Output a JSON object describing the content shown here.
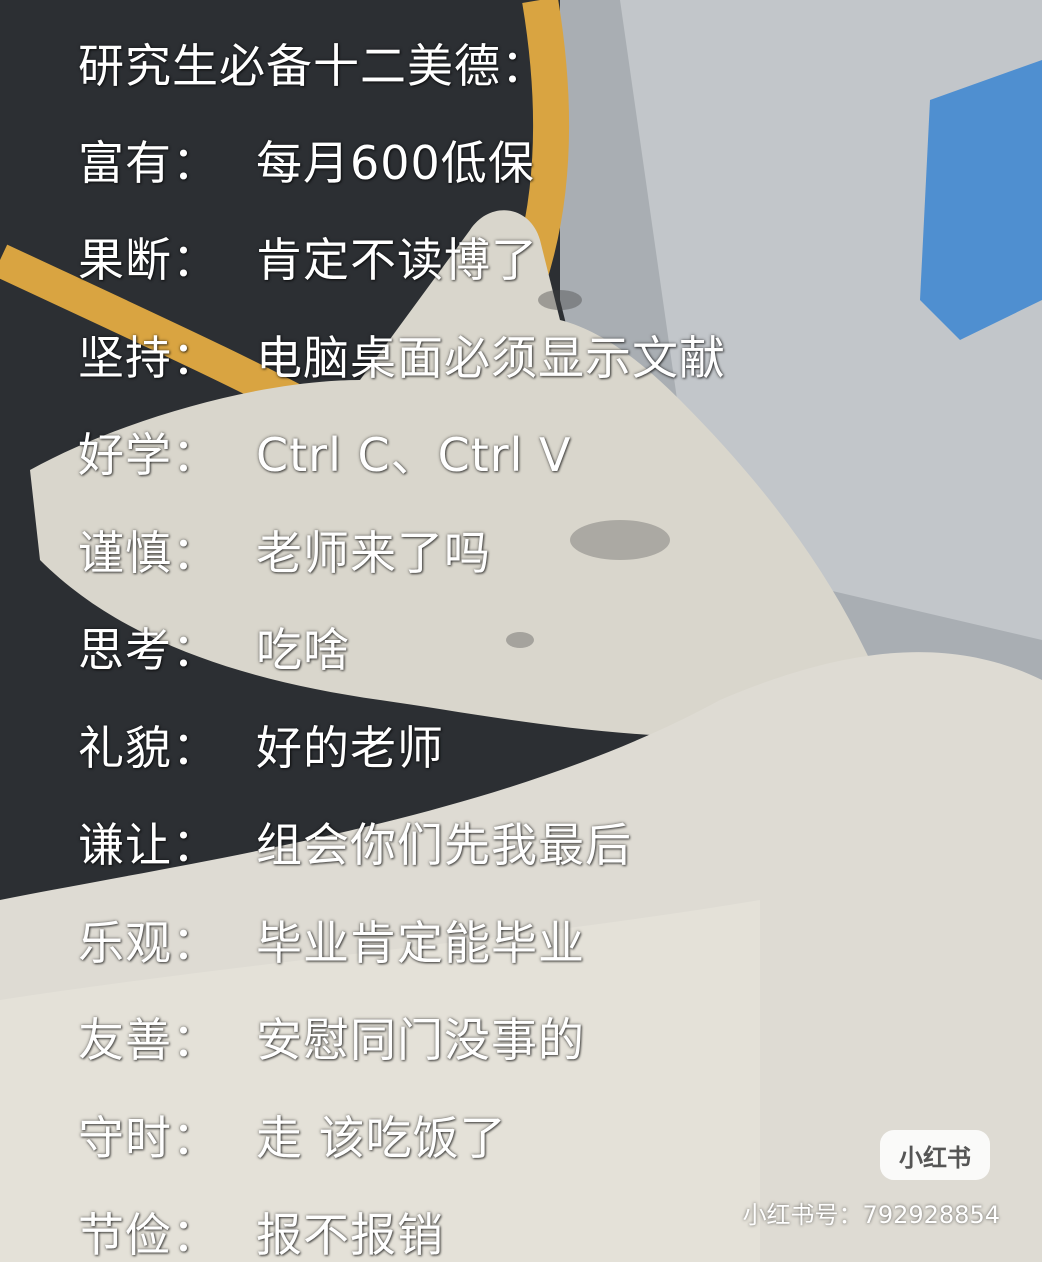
{
  "title": "研究生必备十二美德：",
  "virtues": [
    {
      "label": "富有：",
      "value": "每月600低保"
    },
    {
      "label": "果断：",
      "value": "肯定不读博了"
    },
    {
      "label": "坚持：",
      "value": "电脑桌面必须显示文献"
    },
    {
      "label": "好学：",
      "value": "Ctrl C、Ctrl V"
    },
    {
      "label": "谨慎：",
      "value": "老师来了吗"
    },
    {
      "label": "思考：",
      "value": "吃啥"
    },
    {
      "label": "礼貌：",
      "value": "好的老师"
    },
    {
      "label": "谦让：",
      "value": "组会你们先我最后"
    },
    {
      "label": "乐观：",
      "value": "毕业肯定能毕业"
    },
    {
      "label": "友善：",
      "value": "安慰同门没事的"
    },
    {
      "label": "守时：",
      "value": "走 该吃饭了"
    },
    {
      "label": "节俭：",
      "value": "报不报销"
    }
  ],
  "watermark": {
    "logo": "小红书",
    "account": "小红书号：792928854"
  },
  "colors": {
    "text": "#ffffff",
    "glove": "#d9d6cc",
    "background_dark": "#2c2f33",
    "tube": "#d9a441",
    "blue_block": "#4f8fd0"
  }
}
